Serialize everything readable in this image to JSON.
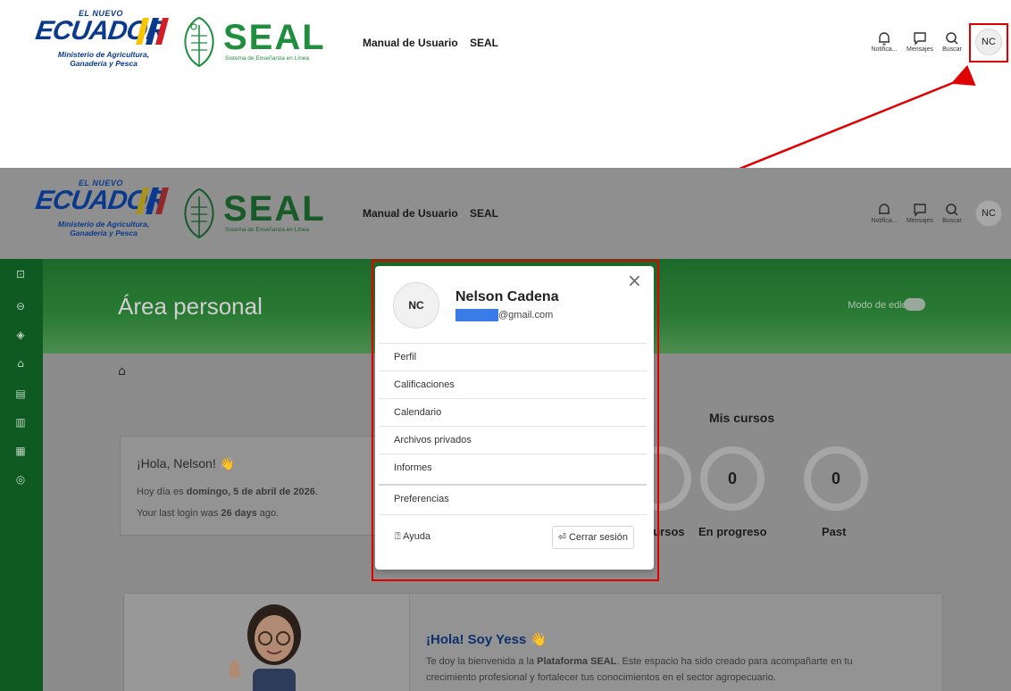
{
  "header": {
    "logo_ecuador": {
      "small_top": "EL NUEVO",
      "main": "ECUADOR",
      "ministry_line1": "Ministerio de Agricultura,",
      "ministry_line2": "Ganadería y Pesca"
    },
    "logo_seal": {
      "word": "SEAL",
      "subtitle": "Sistema de Enseñanza en Línea"
    },
    "nav": [
      "Manual de Usuario",
      "SEAL"
    ],
    "icons": [
      {
        "icon": "bell-icon",
        "label": "Notifica..."
      },
      {
        "icon": "chat-icon",
        "label": "Mensajes"
      },
      {
        "icon": "search-icon",
        "label": "Buscar"
      }
    ],
    "user_initials": "NC"
  },
  "sidebar": {
    "icons": [
      "dashboard-icon",
      "toggle-icon",
      "courses-icon",
      "home-icon",
      "calendar-book-icon",
      "catalog-icon",
      "calendar-icon",
      "badge-icon"
    ]
  },
  "page": {
    "title": "Área personal",
    "edit_mode_label": "Modo de edición"
  },
  "welcome": {
    "greeting": "¡Hola, Nelson! 👋",
    "date_prefix": "Hoy día es ",
    "date_value": "domingo, 5 de abril de 2026",
    "date_suffix": ".",
    "login_prefix": "Your last login was ",
    "login_value": "26 days",
    "login_suffix": " ago."
  },
  "my_courses": {
    "title": "Mis cursos",
    "stats": [
      {
        "label": "cursos",
        "value": ""
      },
      {
        "label": "En progreso",
        "value": "0"
      },
      {
        "label": "Past",
        "value": "0"
      }
    ]
  },
  "assistant": {
    "title": "¡Hola! Soy Yess 👋",
    "text_prefix": "Te doy la bienvenida a la ",
    "text_bold": "Plataforma SEAL",
    "text_suffix": ". Este espacio ha sido creado para acompañarte en tu",
    "text_line2": "crecimiento profesional y fortalecer tus conocimientos en el sector agropecuario."
  },
  "user_menu": {
    "initials": "NC",
    "name": "Nelson Cadena",
    "email_visible": "@gmail.com",
    "items": [
      "Perfil",
      "Calificaciones",
      "Calendario",
      "Archivos privados",
      "Informes",
      "Preferencias"
    ],
    "help_label": "Ayuda",
    "logout_label": "Cerrar sesión"
  },
  "colors": {
    "highlight": "#e00000",
    "brand_green": "#1f8f3f",
    "brand_blue": "#0b3a8c"
  }
}
